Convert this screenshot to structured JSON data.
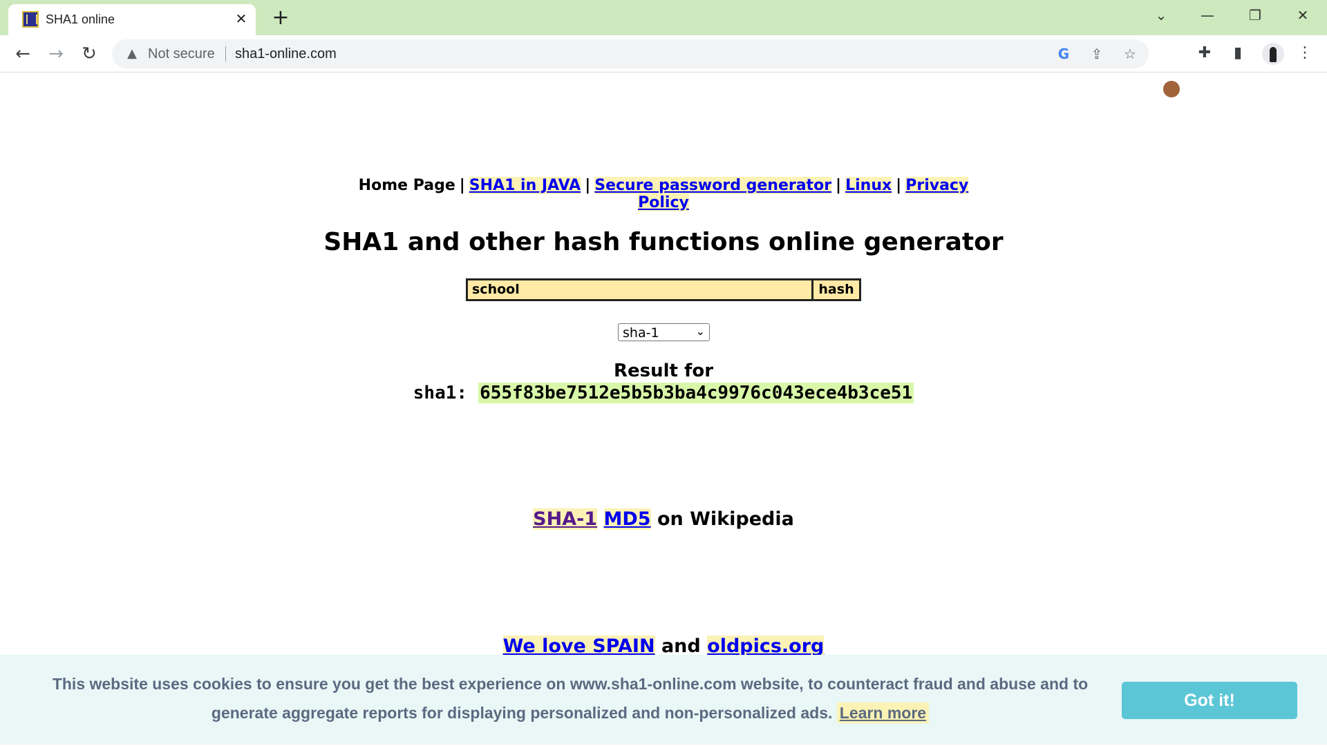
{
  "browser": {
    "tab_title": "SHA1 online",
    "close_glyph": "✕",
    "new_tab_glyph": "+",
    "window_controls": {
      "tab_search": "⌄",
      "minimize": "—",
      "restore": "❐",
      "close": "✕"
    },
    "nav": {
      "back": "←",
      "forward": "→",
      "reload": "↻"
    },
    "security_label": "Not secure",
    "url": "sha1-online.com",
    "icons": [
      "google-icon",
      "share-icon",
      "bookmark-star-icon",
      "cookie-extension-icon",
      "extensions-puzzle-icon",
      "side-panel-icon",
      "profile-avatar",
      "menu-kebab-icon"
    ]
  },
  "top_nav": {
    "home": "Home Page",
    "separator": "|",
    "links": [
      "SHA1 in JAVA",
      "Secure password generator",
      "Linux",
      "Privacy Policy"
    ]
  },
  "main": {
    "title": "SHA1 and other hash functions online generator",
    "input_value": "school",
    "hash_button": "hash",
    "algorithm_selected": "sha-1",
    "result_label": "Result for",
    "result_algo": "sha1:",
    "result_hash": "655f83be7512e5b5b3ba4c9976c043ece4b3ce51"
  },
  "wiki": {
    "link_sha1": "SHA-1",
    "link_md5": "MD5",
    "suffix": "on Wikipedia"
  },
  "promo": {
    "link1": "We love SPAIN",
    "middle": "and",
    "link2": "oldpics.org"
  },
  "cookie_banner": {
    "message": "This website uses cookies to ensure you get the best experience on www.sha1-online.com website, to counteract fraud and abuse and to generate aggregate reports for displaying personalized and non-personalized ads.",
    "learn_more": "Learn more",
    "accept": "Got it!"
  },
  "colors": {
    "tabbar_bg": "#cde9bd",
    "link": "#0000ee",
    "visited_link": "#551a8b",
    "input_bg": "#ffeaa6",
    "hash_highlight": "#d8f7a8",
    "cookie_bg": "#eaf7f7",
    "cookie_button": "#5bc6d6"
  }
}
